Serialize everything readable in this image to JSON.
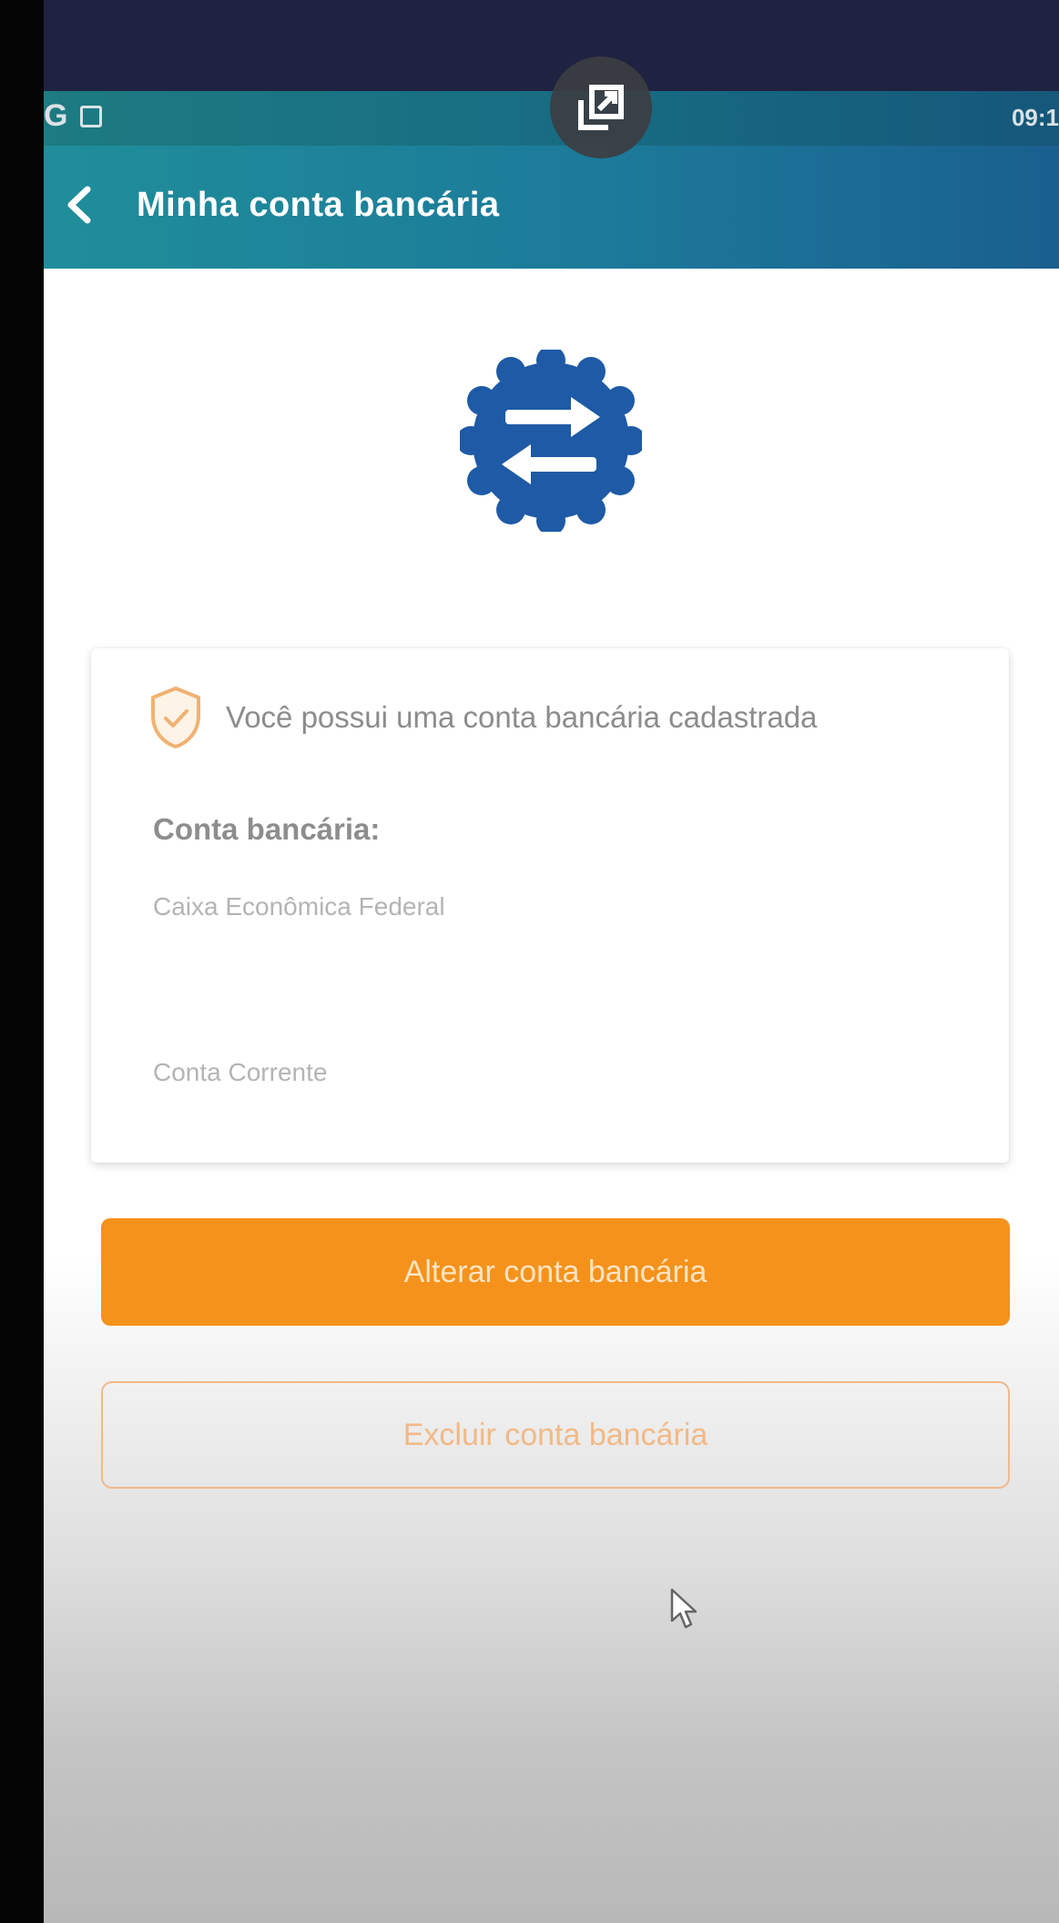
{
  "status_bar": {
    "left_text": "G",
    "time": "09:1"
  },
  "app_bar": {
    "title": "Minha conta bancária"
  },
  "card": {
    "notice": "Você possui uma conta bancária cadastrada",
    "account_label": "Conta bancária:",
    "bank_name": "Caixa Econômica Federal",
    "account_type": "Conta Corrente"
  },
  "actions": {
    "primary_label": "Alterar conta bancária",
    "secondary_label": "Excluir conta bancária"
  },
  "colors": {
    "status_bar": "#1d7b82",
    "app_bar": "#1c7a9a",
    "badge_blue": "#1e5aa6",
    "accent_orange": "#f4921b",
    "outline_orange": "#f0b98a"
  },
  "icons": {
    "back": "chevron-left-icon",
    "pip": "picture-in-picture-icon",
    "badge": "swap-arrows-badge-icon",
    "shield": "shield-check-icon",
    "cursor": "mouse-pointer-icon"
  }
}
